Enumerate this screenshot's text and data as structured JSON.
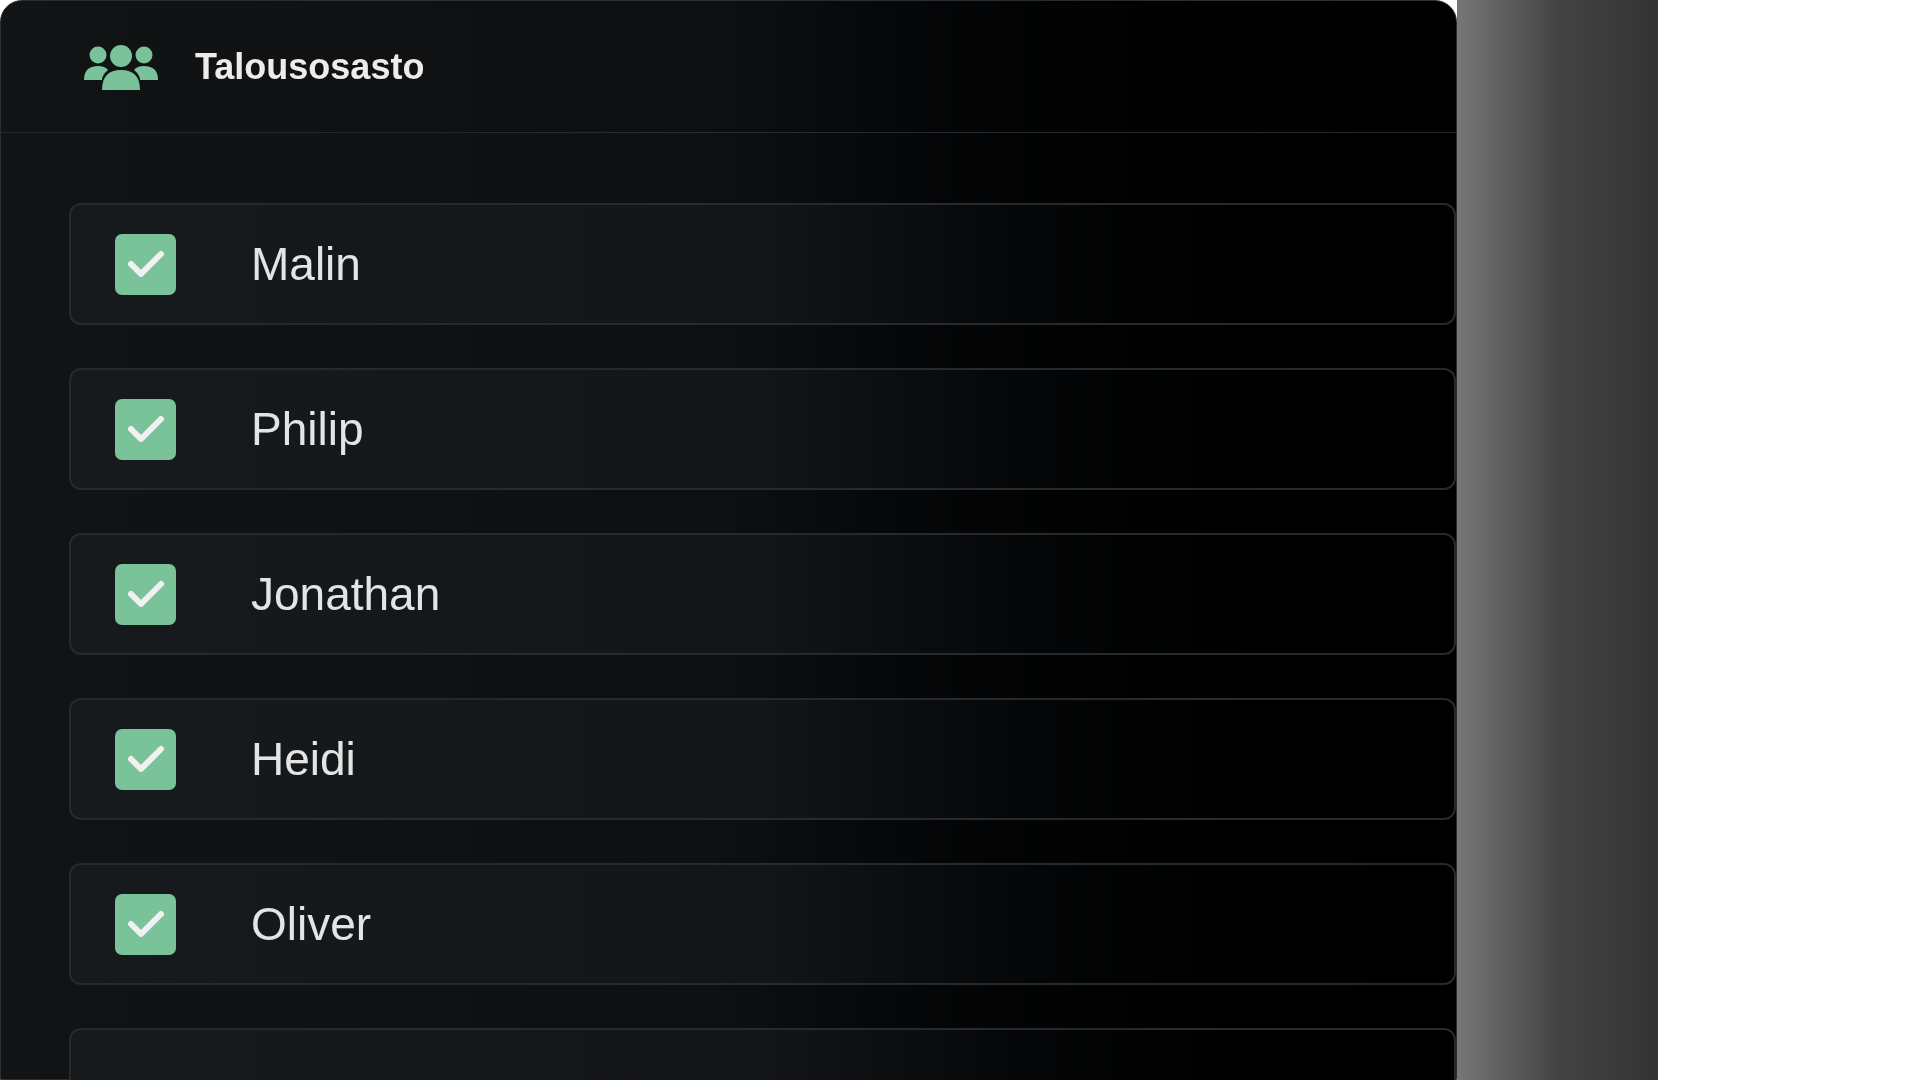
{
  "header": {
    "title": "Talousosasto"
  },
  "members": [
    {
      "name": "Malin",
      "checked": true
    },
    {
      "name": "Philip",
      "checked": true
    },
    {
      "name": "Jonathan",
      "checked": true
    },
    {
      "name": "Heidi",
      "checked": true
    },
    {
      "name": "Oliver",
      "checked": true
    }
  ]
}
